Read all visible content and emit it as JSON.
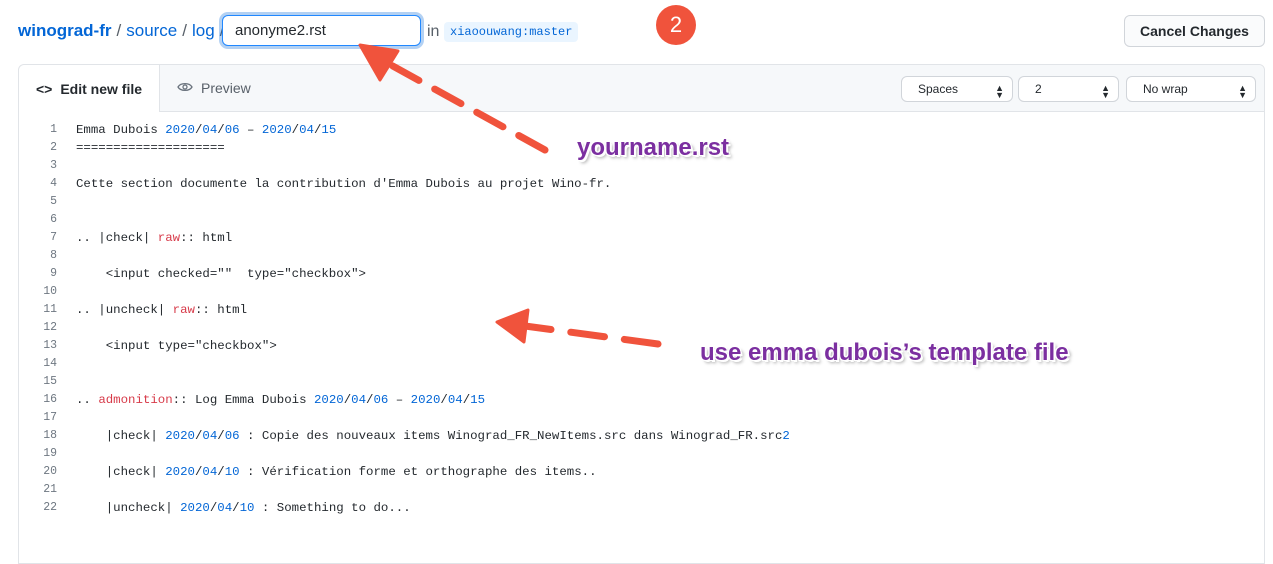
{
  "breadcrumb": {
    "repo": "winograd-fr",
    "sep": "/",
    "dir1": "source",
    "dir2": "log"
  },
  "filename": {
    "value": "anonyme2.rst"
  },
  "branch": {
    "in_label": "in",
    "name": "xiaoouwang:master"
  },
  "step_badge": "2",
  "cancel_label": "Cancel Changes",
  "editor": {
    "tabs": {
      "edit_label": "Edit new file",
      "preview_label": "Preview"
    },
    "indent_mode": "Spaces",
    "indent_size": "2",
    "wrap_mode": "No wrap"
  },
  "code_lines": [
    [
      [
        "Emma Dubois ",
        ""
      ],
      [
        "2020",
        "num"
      ],
      [
        "/",
        ""
      ],
      [
        "04",
        "num"
      ],
      [
        "/",
        ""
      ],
      [
        "06",
        "num"
      ],
      [
        " – ",
        ""
      ],
      [
        "2020",
        "num"
      ],
      [
        "/",
        ""
      ],
      [
        "04",
        "num"
      ],
      [
        "/",
        ""
      ],
      [
        "15",
        "num"
      ]
    ],
    [
      [
        "====================",
        ""
      ]
    ],
    [],
    [
      [
        "Cette section documente la contribution d'Emma Dubois au projet Wino-fr.",
        ""
      ]
    ],
    [],
    [],
    [
      [
        ".. |check| ",
        ""
      ],
      [
        "raw",
        "kw"
      ],
      [
        ":: html",
        ""
      ]
    ],
    [],
    [
      [
        "    <input checked=\"\"  type=\"checkbox\">",
        ""
      ]
    ],
    [],
    [
      [
        ".. |uncheck| ",
        ""
      ],
      [
        "raw",
        "kw"
      ],
      [
        ":: html",
        ""
      ]
    ],
    [],
    [
      [
        "    <input type=\"checkbox\">",
        ""
      ]
    ],
    [],
    [],
    [
      [
        ".. ",
        ""
      ],
      [
        "admonition",
        "kw"
      ],
      [
        ":: Log Emma Dubois ",
        ""
      ],
      [
        "2020",
        "num"
      ],
      [
        "/",
        ""
      ],
      [
        "04",
        "num"
      ],
      [
        "/",
        ""
      ],
      [
        "06",
        "num"
      ],
      [
        " – ",
        ""
      ],
      [
        "2020",
        "num"
      ],
      [
        "/",
        ""
      ],
      [
        "04",
        "num"
      ],
      [
        "/",
        ""
      ],
      [
        "15",
        "num"
      ]
    ],
    [],
    [
      [
        "    |check| ",
        ""
      ],
      [
        "2020",
        "num"
      ],
      [
        "/",
        ""
      ],
      [
        "04",
        "num"
      ],
      [
        "/",
        ""
      ],
      [
        "06",
        "num"
      ],
      [
        " : Copie des nouveaux items Winograd_FR_NewItems.src dans Winograd_FR.src",
        ""
      ],
      [
        "2",
        "num"
      ]
    ],
    [],
    [
      [
        "    |check| ",
        ""
      ],
      [
        "2020",
        "num"
      ],
      [
        "/",
        ""
      ],
      [
        "04",
        "num"
      ],
      [
        "/",
        ""
      ],
      [
        "10",
        "num"
      ],
      [
        " : Vérification forme et orthographe des items..",
        ""
      ]
    ],
    [],
    [
      [
        "    |uncheck| ",
        ""
      ],
      [
        "2020",
        "num"
      ],
      [
        "/",
        ""
      ],
      [
        "04",
        "num"
      ],
      [
        "/",
        ""
      ],
      [
        "10",
        "num"
      ],
      [
        " : Something to do...",
        ""
      ]
    ]
  ],
  "annotations": {
    "top": "yourname.rst",
    "middle": "use emma dubois’s template file"
  },
  "colors": {
    "accent": "#0366d6",
    "badge": "#f0533c",
    "annotation_text": "#7b2fa0",
    "arrow": "#f0533c",
    "keyword": "#d73a49"
  },
  "icons": {
    "code": "code-brackets-icon",
    "preview": "eye-icon",
    "select_arrows": "up-down-caret-icon"
  }
}
